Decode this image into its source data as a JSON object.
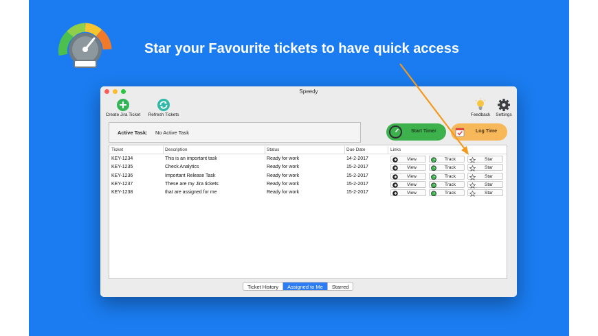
{
  "headline": "Star your Favourite tickets to have quick access",
  "colors": {
    "background": "#1a7cf0",
    "accent": "#2b7cf5",
    "start_timer": "#3db14b",
    "log_time": "#f7b85a",
    "arrow": "#f39a1e"
  },
  "window": {
    "title": "Speedy"
  },
  "toolbar": {
    "create_label": "Create Jira Ticket",
    "refresh_label": "Refresh Tickets",
    "feedback_label": "Feedback",
    "settings_label": "Settings",
    "icons": [
      "plus-circle-icon",
      "refresh-icon",
      "lightbulb-icon",
      "gear-icon"
    ]
  },
  "active_task": {
    "label": "Active Task:",
    "value": "No Active Task"
  },
  "buttons": {
    "start_timer": "Start Timer",
    "log_time": "Log Time"
  },
  "table": {
    "headers": [
      "Ticket",
      "Description",
      "Status",
      "Due Date",
      "Links"
    ],
    "rows": [
      {
        "ticket": "KEY-1234",
        "description": "This is an important task",
        "status": "Ready for work",
        "due": "14-2-2017"
      },
      {
        "ticket": "KEY-1235",
        "description": "Check Analytics",
        "status": "Ready for work",
        "due": "15-2-2017"
      },
      {
        "ticket": "KEY-1236",
        "description": "Important Release Task",
        "status": "Ready for work",
        "due": "15-2-2017"
      },
      {
        "ticket": "KEY-1237",
        "description": "These are my Jira tickets",
        "status": "Ready for work",
        "due": "15-2-2017"
      },
      {
        "ticket": "KEY-1238",
        "description": "that are assigned for me",
        "status": "Ready for work",
        "due": "15-2-2017"
      }
    ],
    "link_labels": {
      "view": "View",
      "track": "Track",
      "star": "Star"
    }
  },
  "tabs": [
    {
      "label": "Ticket History",
      "active": false
    },
    {
      "label": "Assigned to Me",
      "active": true
    },
    {
      "label": "Starred",
      "active": false
    }
  ]
}
